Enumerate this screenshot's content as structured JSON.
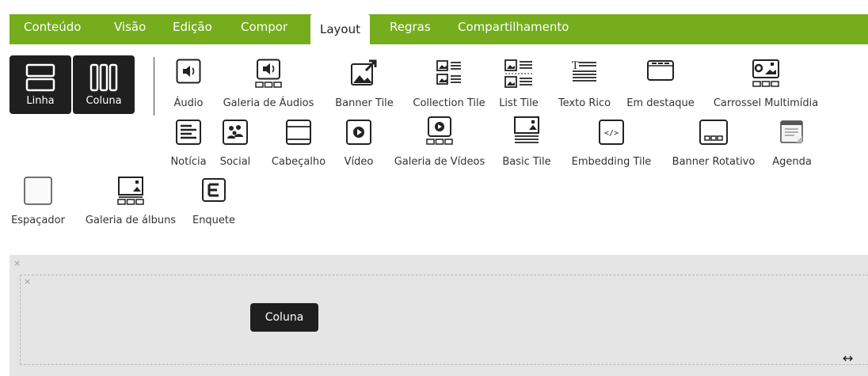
{
  "tabs": [
    {
      "label": "Conteúdo",
      "active": false
    },
    {
      "label": "Visão",
      "active": false
    },
    {
      "label": "Edição",
      "active": false
    },
    {
      "label": "Compor",
      "active": false
    },
    {
      "label": "Layout",
      "active": true
    },
    {
      "label": "Regras",
      "active": false
    },
    {
      "label": "Compartilhamento",
      "active": false
    }
  ],
  "layout_buttons": {
    "row_label": "Linha",
    "column_label": "Coluna"
  },
  "tiles_row1": [
    {
      "label": "Áudio",
      "icon": "audio-icon"
    },
    {
      "label": "Galeria de Áudios",
      "icon": "audio-gallery-icon"
    },
    {
      "label": "Banner Tile",
      "icon": "banner-tile-icon"
    },
    {
      "label": "Collection Tile",
      "icon": "collection-tile-icon"
    },
    {
      "label": "List Tile",
      "icon": "list-tile-icon"
    },
    {
      "label": "Texto Rico",
      "icon": "rich-text-icon"
    },
    {
      "label": "Em destaque",
      "icon": "featured-icon"
    },
    {
      "label": "Carrossel Multimídia",
      "icon": "carousel-icon"
    }
  ],
  "tiles_row2": [
    {
      "label": "Notícia",
      "icon": "news-icon"
    },
    {
      "label": "Social",
      "icon": "social-icon"
    },
    {
      "label": "Cabeçalho",
      "icon": "header-icon"
    },
    {
      "label": "Vídeo",
      "icon": "video-icon"
    },
    {
      "label": "Galeria de Vídeos",
      "icon": "video-gallery-icon"
    },
    {
      "label": "Basic Tile",
      "icon": "basic-tile-icon"
    },
    {
      "label": "Embedding Tile",
      "icon": "embed-icon"
    },
    {
      "label": "Banner Rotativo",
      "icon": "rotating-banner-icon"
    },
    {
      "label": "Agenda",
      "icon": "agenda-icon"
    }
  ],
  "tiles_row3": [
    {
      "label": "Espaçador",
      "icon": "spacer-icon"
    },
    {
      "label": "Galeria de álbuns",
      "icon": "album-gallery-icon"
    },
    {
      "label": "Enquete",
      "icon": "poll-icon"
    }
  ],
  "canvas": {
    "close_glyph": "×",
    "column_button_label": "Coluna",
    "resize_glyph": "↔"
  }
}
